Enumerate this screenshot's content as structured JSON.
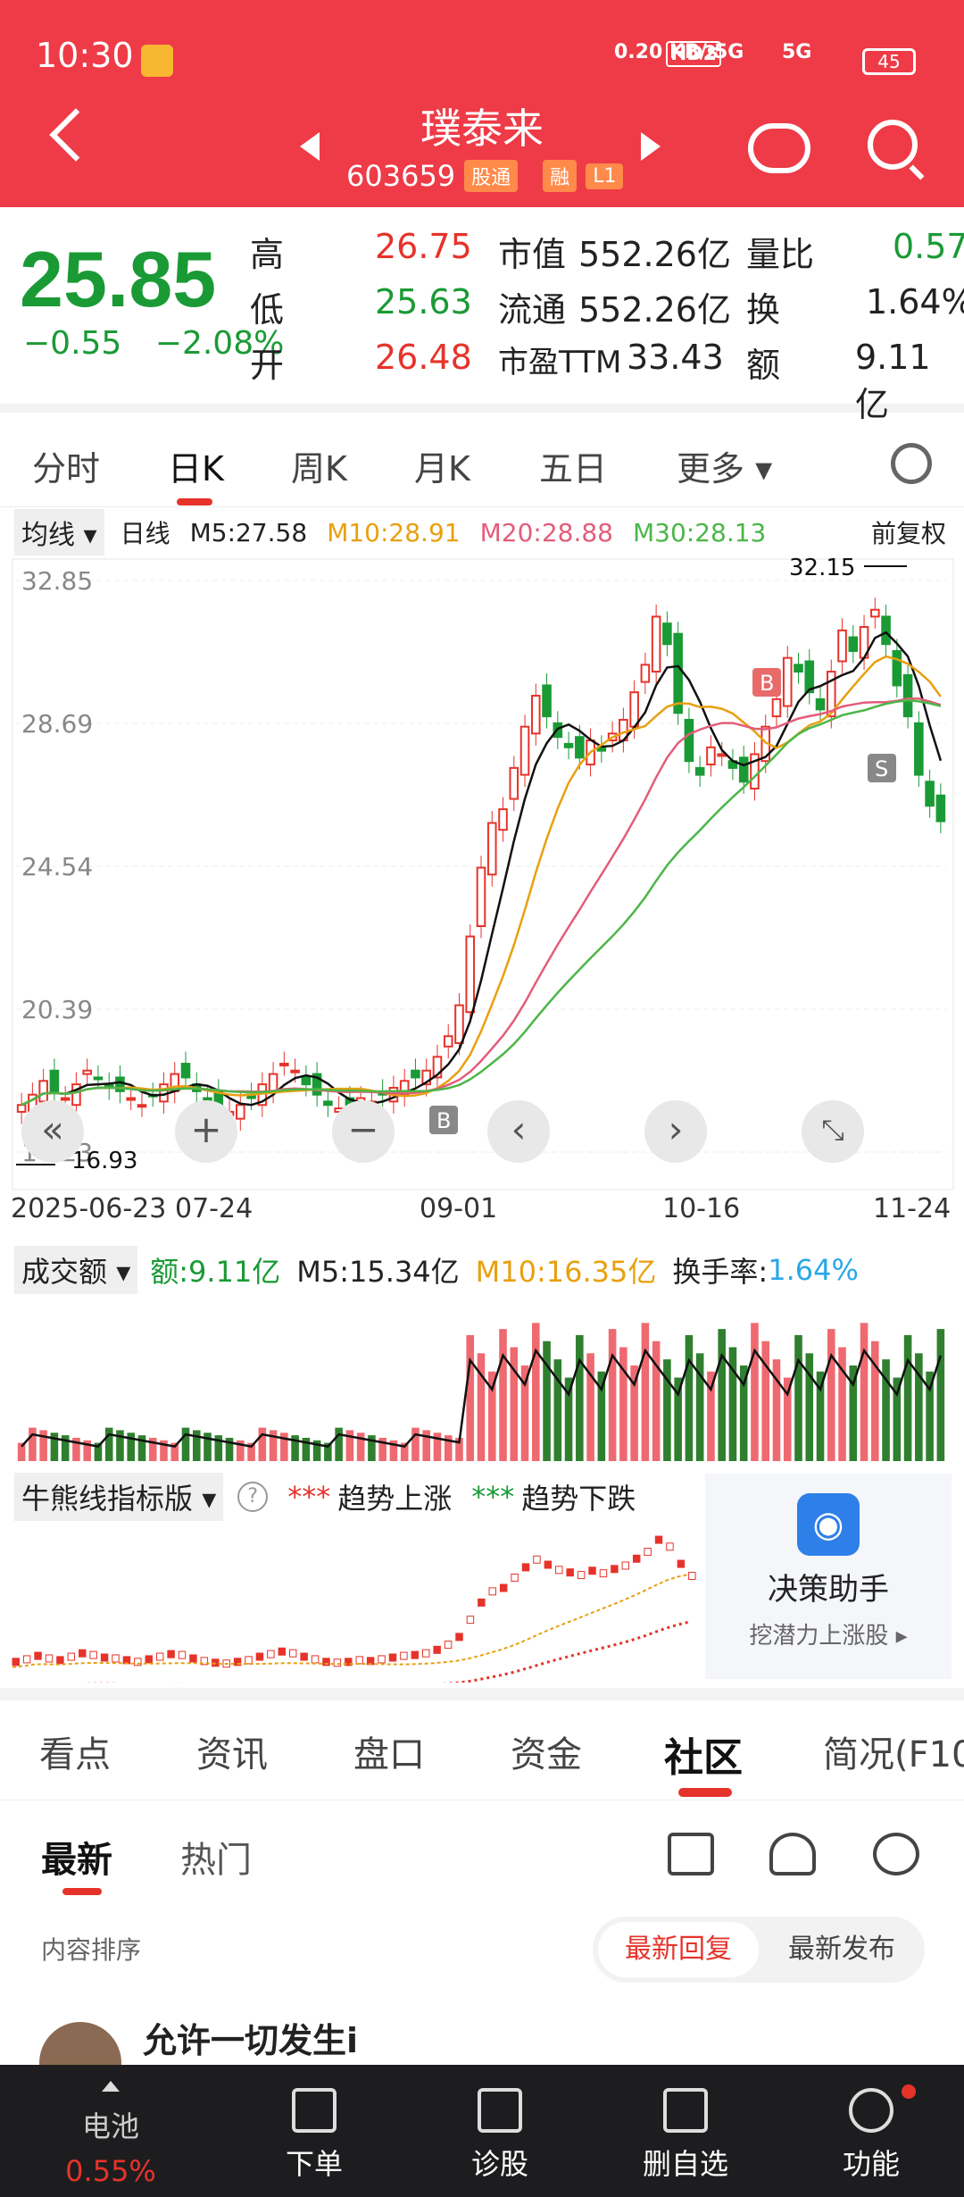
{
  "status_bar": {
    "time": "10:30",
    "net": "0.20 KB/s",
    "hd": "HD2",
    "sig1": "5G",
    "sig2": "5G",
    "battery": "45"
  },
  "header": {
    "title": "璞泰来",
    "code": "603659",
    "tags": [
      "股通",
      "融",
      "L1"
    ]
  },
  "quote": {
    "price": "25.85",
    "change": "−0.55",
    "change_pct": "−2.08%",
    "col1": [
      {
        "label": "高",
        "value": "26.75"
      },
      {
        "label": "低",
        "value": "25.63"
      },
      {
        "label": "开",
        "value": "26.48"
      }
    ],
    "col2": [
      {
        "label": "市值",
        "value": "552.26亿"
      },
      {
        "label": "流通",
        "value": "552.26亿"
      },
      {
        "label": "市盈TTM",
        "value": "33.43"
      }
    ],
    "col3": [
      {
        "label": "量比",
        "value": "0.57"
      },
      {
        "label": "换",
        "value": "1.64%"
      },
      {
        "label": "额",
        "value": "9.11亿"
      }
    ],
    "colors": {
      "up": "#e6332a",
      "down": "#1a9a35"
    }
  },
  "kline_tabs": [
    "分时",
    "日K",
    "周K",
    "月K",
    "五日",
    "更多"
  ],
  "ma_row": {
    "chip": "均线",
    "mode": "日线",
    "m5": "M5:27.58",
    "m10": "M10:28.91",
    "m20": "M20:28.88",
    "m30": "M30:28.13",
    "adjust": "前复权"
  },
  "chart_data": {
    "type": "candlestick",
    "y_ticks": [
      "32.85",
      "28.69",
      "24.54",
      "20.39",
      "16.23"
    ],
    "ylim": [
      16.23,
      32.85
    ],
    "high_label": "32.15",
    "low_label": "16.93",
    "dates": [
      "2025-06-23",
      "07-24",
      "09-01",
      "10-16",
      "11-24"
    ],
    "markers": [
      "B",
      "B",
      "S"
    ],
    "closes": [
      17.6,
      17.9,
      18.3,
      18.0,
      17.8,
      18.2,
      18.6,
      18.4,
      18.1,
      18.0,
      17.8,
      17.6,
      17.9,
      18.2,
      18.5,
      18.4,
      18.0,
      17.7,
      17.5,
      17.4,
      17.6,
      17.8,
      18.2,
      18.5,
      18.8,
      18.6,
      18.2,
      17.9,
      17.6,
      17.5,
      17.6,
      17.8,
      17.7,
      17.9,
      18.1,
      18.3,
      18.4,
      18.6,
      19.0,
      19.6,
      20.5,
      22.5,
      24.5,
      25.8,
      26.2,
      27.4,
      28.6,
      29.5,
      28.9,
      28.3,
      28.0,
      27.7,
      28.2,
      27.9,
      28.4,
      28.8,
      29.6,
      30.4,
      31.8,
      31.0,
      29.0,
      27.6,
      27.2,
      28.0,
      27.8,
      27.4,
      27.0,
      27.8,
      28.6,
      29.4,
      30.6,
      30.2,
      29.6,
      29.1,
      30.2,
      31.4,
      30.8,
      31.5,
      32.0,
      31.0,
      29.8,
      28.9,
      27.2,
      26.3,
      25.85
    ],
    "ma5": "M5:27.58",
    "ma10": "M10:28.91",
    "ma20": "M20:28.88",
    "ma30": "M30:28.13"
  },
  "volume": {
    "chip": "成交额",
    "amount": "额:9.11亿",
    "m5": "M5:15.34亿",
    "m10": "M10:16.35亿",
    "turnover_label": "换手率:",
    "turnover": "1.64%"
  },
  "bull_bear": {
    "chip": "牛熊线指标版",
    "help": "?",
    "up_label": "趋势上涨",
    "down_label": "趋势下跌"
  },
  "assistant": {
    "title": "决策助手",
    "sub": "挖潜力上涨股 ▸"
  },
  "section_tabs": [
    "看点",
    "资讯",
    "盘口",
    "资金",
    "社区",
    "简况(F10"
  ],
  "sub_tabs": [
    "最新",
    "热门"
  ],
  "sort": {
    "label": "内容排序",
    "on": "最新回复",
    "off": "最新发布"
  },
  "post": {
    "user": "允许一切发生i"
  },
  "tabbar": [
    {
      "label": "电池",
      "sub": "0.55%"
    },
    {
      "label": "下单"
    },
    {
      "label": "诊股"
    },
    {
      "label": "删自选"
    },
    {
      "label": "功能"
    }
  ]
}
